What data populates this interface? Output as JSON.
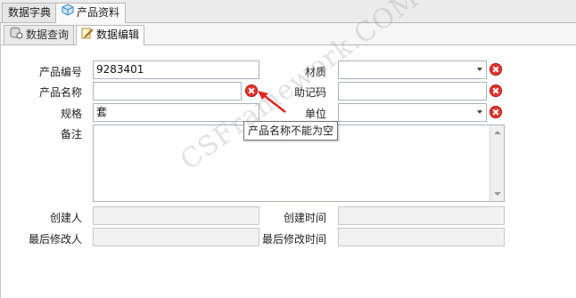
{
  "outer_tabs": [
    {
      "label": "数据字典",
      "icon": "none",
      "active": false
    },
    {
      "label": "产品资料",
      "icon": "cube-icon",
      "active": true
    }
  ],
  "inner_tabs": [
    {
      "label": "数据查询",
      "icon": "database-icon",
      "active": false
    },
    {
      "label": "数据编辑",
      "icon": "edit-icon",
      "active": true
    }
  ],
  "form": {
    "product_code": {
      "label": "产品编号",
      "value": "9283401"
    },
    "product_name": {
      "label": "产品名称",
      "value": ""
    },
    "spec": {
      "label": "规格",
      "value": "套"
    },
    "remark": {
      "label": "备注",
      "value": ""
    },
    "material": {
      "label": "材质",
      "value": ""
    },
    "mnemonic": {
      "label": "助记码",
      "value": ""
    },
    "unit": {
      "label": "单位",
      "value": ""
    },
    "created_by": {
      "label": "创建人",
      "value": ""
    },
    "created_time": {
      "label": "创建时间",
      "value": ""
    },
    "modified_by": {
      "label": "最后修改人",
      "value": ""
    },
    "modified_time": {
      "label": "最后修改时间",
      "value": ""
    }
  },
  "validation": {
    "tooltip": "产品名称不能为空",
    "error_color": "#e03a32"
  },
  "watermark": "CSFramework.COM"
}
